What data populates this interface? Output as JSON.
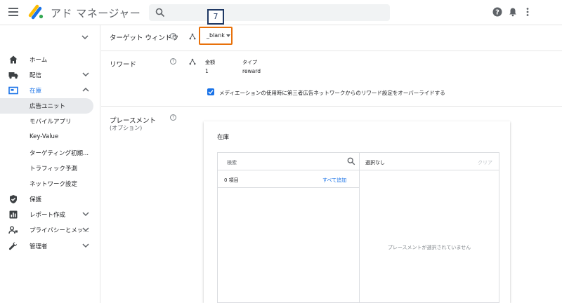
{
  "header": {
    "app_title": "アド マネージャー",
    "icons": [
      "menu-icon",
      "ad-manager-logo",
      "search-icon",
      "help-icon",
      "notifications-icon",
      "more-vert-icon"
    ]
  },
  "sidebar": {
    "items": [
      {
        "label": "ホーム",
        "icon": "home-icon"
      },
      {
        "label": "配信",
        "icon": "delivery-truck-icon",
        "expand": "chevron-down"
      },
      {
        "label": "在庫",
        "icon": "inventory-icon",
        "expand": "chevron-up",
        "active": true
      },
      {
        "label": "保護",
        "icon": "shield-icon"
      },
      {
        "label": "レポート作成",
        "icon": "reports-icon",
        "expand": "chevron-down"
      },
      {
        "label": "プライバシーとメッ...",
        "icon": "privacy-icon",
        "expand": "chevron-down"
      },
      {
        "label": "管理者",
        "icon": "wrench-icon",
        "expand": "chevron-down"
      }
    ],
    "inventory_subitems": [
      "広告ユニット",
      "モバイルアプリ",
      "Key-Value",
      "ターゲティング初期...",
      "トラフィック予測",
      "ネットワーク設定"
    ],
    "selected_subitem": "広告ユニット"
  },
  "main": {
    "target_window": {
      "label": "ターゲット ウィンドウ",
      "value": "_blank"
    },
    "annotation_badge": "7",
    "reward": {
      "label": "リワード",
      "amount_label": "金額",
      "amount_value": "1",
      "type_label": "タイプ",
      "type_value": "reward",
      "checkbox_label": "メディエーションの使用時に第三者広告ネットワークからのリワード設定をオーバーライドする",
      "checkbox_checked": true
    },
    "placement": {
      "label": "プレースメント",
      "sublabel": "(オプション)",
      "card_title": "在庫",
      "search_placeholder": "検索",
      "count_text": "0 項目",
      "add_all_link": "すべて追加",
      "right_header": "選択なし",
      "clear_link": "クリア",
      "empty_message": "プレースメントが選択されていません"
    }
  },
  "colors": {
    "accent": "#1a73e8",
    "highlight": "#e8710a",
    "badge": "#1f3864"
  }
}
